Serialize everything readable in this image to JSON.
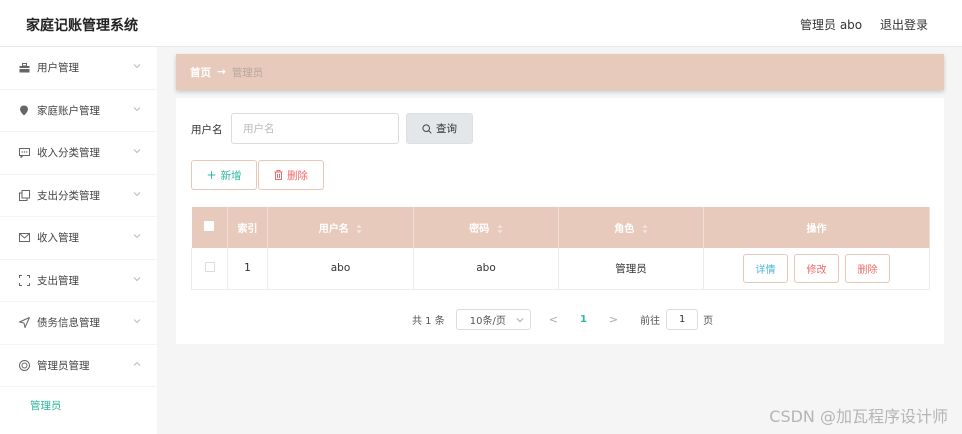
{
  "header": {
    "app_title": "家庭记账管理系统",
    "user_label": "管理员 abo",
    "logout_label": "退出登录"
  },
  "sidebar": {
    "items": [
      {
        "label": "用户管理",
        "icon": "briefcase-icon"
      },
      {
        "label": "家庭账户管理",
        "icon": "location-pin-icon"
      },
      {
        "label": "收入分类管理",
        "icon": "chat-icon"
      },
      {
        "label": "支出分类管理",
        "icon": "copy-icon"
      },
      {
        "label": "收入管理",
        "icon": "message-icon"
      },
      {
        "label": "支出管理",
        "icon": "frame-icon"
      },
      {
        "label": "债务信息管理",
        "icon": "send-icon"
      },
      {
        "label": "管理员管理",
        "icon": "circle-icon"
      }
    ],
    "sub_item": "管理员"
  },
  "breadcrumb": {
    "home": "首页",
    "arrow": "→",
    "current": "管理员"
  },
  "search": {
    "label": "用户名",
    "placeholder": "用户名",
    "value": "",
    "button": "查询"
  },
  "actions": {
    "add": "新增",
    "delete": "删除"
  },
  "table": {
    "columns": [
      "",
      "索引",
      "用户名",
      "密码",
      "角色",
      "操作"
    ],
    "rows": [
      {
        "index": "1",
        "username": "abo",
        "password": "abo",
        "role": "管理员"
      }
    ],
    "ops": {
      "detail": "详情",
      "edit": "修改",
      "remove": "删除"
    }
  },
  "pagination": {
    "total": "共 1 条",
    "page_size": "10条/页",
    "prev": "<",
    "current": "1",
    "next": ">",
    "goto_label": "前往",
    "goto_value": "1",
    "page_word": "页"
  },
  "watermark": "CSDN @加瓦程序设计师",
  "colors": {
    "accent": "#e7cabb",
    "teal": "#2fb8a0",
    "danger": "#f06a6a",
    "info": "#4bb5d8"
  }
}
